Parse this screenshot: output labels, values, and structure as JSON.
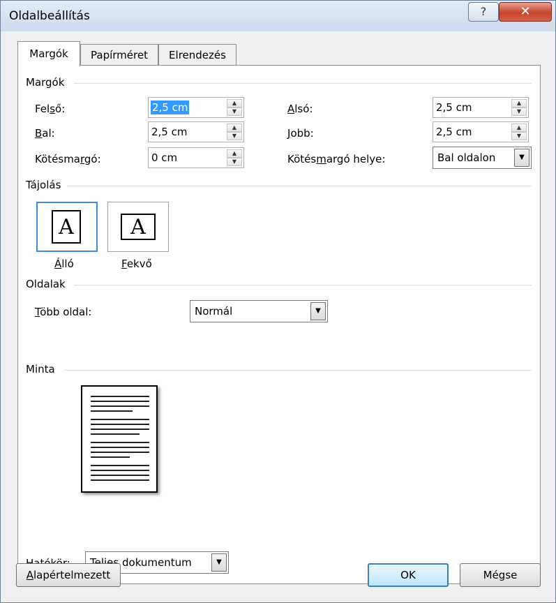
{
  "window": {
    "title": "Oldalbeállítás",
    "help_label": "?",
    "close_label": "✕"
  },
  "tabs": [
    {
      "label": "Margók"
    },
    {
      "label": "Papírméret"
    },
    {
      "label": "Elrendezés"
    }
  ],
  "margins": {
    "group_label": "Margók",
    "top": {
      "label_pre": "Fel",
      "label_u": "s",
      "label_post": "ő:",
      "value": "2,5 cm"
    },
    "bottom": {
      "label_pre": "",
      "label_u": "A",
      "label_post": "lsó:",
      "value": "2,5 cm"
    },
    "left": {
      "label_pre": "",
      "label_u": "B",
      "label_post": "al:",
      "value": "2,5 cm"
    },
    "right": {
      "label_pre": "",
      "label_u": "J",
      "label_post": "obb:",
      "value": "2,5 cm"
    },
    "gutter": {
      "label_pre": "Kötésma",
      "label_u": "r",
      "label_post": "gó:",
      "value": "0 cm"
    },
    "gutter_pos": {
      "label_pre": "Kötés",
      "label_u": "m",
      "label_post": "argó helye:",
      "value": "Bal oldalon"
    }
  },
  "orientation": {
    "group_label": "Tájolás",
    "portrait": {
      "label_u": "Á",
      "label_post": "lló",
      "glyph": "A"
    },
    "landscape": {
      "label_u": "F",
      "label_post": "ekvő",
      "glyph": "A"
    }
  },
  "pages": {
    "group_label": "Oldalak",
    "multiple": {
      "label_u": "T",
      "label_post": "öbb oldal:",
      "value": "Normál"
    }
  },
  "preview": {
    "group_label": "Minta"
  },
  "apply": {
    "label_u": "H",
    "label_post": "atókör:",
    "value": "Teljes dokumentum"
  },
  "buttons": {
    "default_u": "A",
    "default_post": "lapértelmezett",
    "ok": "OK",
    "cancel": "Mégse"
  }
}
